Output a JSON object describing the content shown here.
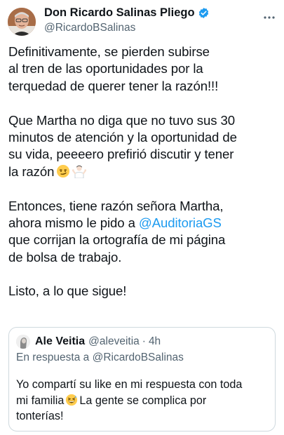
{
  "author": {
    "display_name": "Don Ricardo Salinas Pliego",
    "handle": "@RicardoBSalinas",
    "verified": true,
    "avatar_icon": "profile-photo-icon",
    "more_icon": "more-options-icon"
  },
  "tweet": {
    "lines": {
      "l1": "Definitivamente, se pierden subirse",
      "l2": "al tren de las oportunidades por la",
      "l3": "terquedad de querer tener la razón!!!",
      "l4": "Que Martha no diga que no tuvo sus 30",
      "l5": "minutos de atención y la oportunidad de",
      "l6": "su vida, peeeero prefirió discutir y tener",
      "l7": "la razón",
      "l8": "Entonces, tiene razón señora Martha,",
      "l9": "ahora mismo le pido a",
      "l10": "que corrijan la ortografía de mi página",
      "l11": "de bolsa de trabajo.",
      "l12": "Listo, a lo que sigue!"
    },
    "mention": "@AuditoriaGS",
    "emojis": [
      "smirking-face-icon",
      "person-shrugging-icon"
    ]
  },
  "quote": {
    "display_name": "Ale Veitia",
    "handle": "@aleveitia",
    "separator": "·",
    "time": "4h",
    "reply_prefix": "En respuesta a",
    "reply_to": "@RicardoBSalinas",
    "lines": {
      "l1": "Yo compartí su like en mi respuesta con toda",
      "l2a": "mi familia",
      "l2b": "La gente se complica por",
      "l3": "tonterías!"
    },
    "emoji": "grinning-squinting-sweat-face-icon"
  },
  "colors": {
    "text": "#0f1419",
    "secondary": "#536471",
    "link": "#1d9bf0",
    "border": "#cfd9de",
    "verified": "#1d9bf0"
  }
}
